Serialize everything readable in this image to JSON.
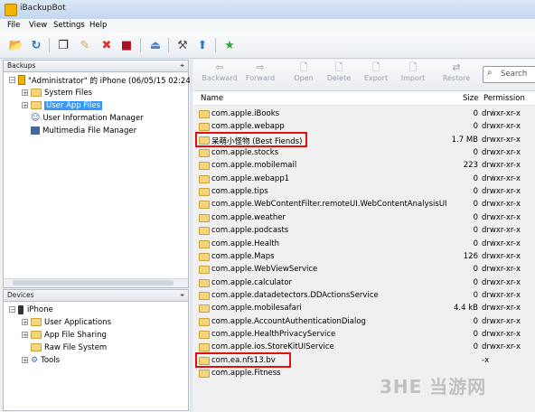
{
  "window": {
    "title": "iBackupBot"
  },
  "menu": [
    "File",
    "View",
    "Settings",
    "Help"
  ],
  "backups": {
    "header": "Backups",
    "root": "\"Administrator\" 的 iPhone (06/05/15 02:24",
    "items": [
      "System Files",
      "User App Files",
      "User Information Manager",
      "Multimedia File Manager"
    ]
  },
  "devices": {
    "header": "Devices",
    "root": "iPhone",
    "items": [
      "User Applications",
      "App File Sharing",
      "Raw File System",
      "Tools"
    ]
  },
  "right_toolbar": {
    "buttons": [
      "Backward",
      "Forward",
      "Open",
      "Delete",
      "Export",
      "Import",
      "Restore"
    ],
    "search_placeholder": "Search"
  },
  "file_list": {
    "columns": {
      "name": "Name",
      "size": "Size",
      "permission": "Permission"
    },
    "rows": [
      {
        "name": "com.apple.iBooks",
        "size": "0",
        "perm": "drwxr-xr-x"
      },
      {
        "name": "com.apple.webapp",
        "size": "0",
        "perm": "drwxr-xr-x"
      },
      {
        "name": "呆萌小怪物 (Best Fiends)",
        "size": "1.7 MB",
        "perm": "drwxr-xr-x"
      },
      {
        "name": "com.apple.stocks",
        "size": "0",
        "perm": "drwxr-xr-x"
      },
      {
        "name": "com.apple.mobilemail",
        "size": "223",
        "perm": "drwxr-xr-x"
      },
      {
        "name": "com.apple.webapp1",
        "size": "0",
        "perm": "drwxr-xr-x"
      },
      {
        "name": "com.apple.tips",
        "size": "0",
        "perm": "drwxr-xr-x"
      },
      {
        "name": "com.apple.WebContentFilter.remoteUI.WebContentAnalysisUI",
        "size": "0",
        "perm": "drwxr-xr-x"
      },
      {
        "name": "com.apple.weather",
        "size": "0",
        "perm": "drwxr-xr-x"
      },
      {
        "name": "com.apple.podcasts",
        "size": "0",
        "perm": "drwxr-xr-x"
      },
      {
        "name": "com.apple.Health",
        "size": "0",
        "perm": "drwxr-xr-x"
      },
      {
        "name": "com.apple.Maps",
        "size": "126",
        "perm": "drwxr-xr-x"
      },
      {
        "name": "com.apple.WebViewService",
        "size": "0",
        "perm": "drwxr-xr-x"
      },
      {
        "name": "com.apple.calculator",
        "size": "0",
        "perm": "drwxr-xr-x"
      },
      {
        "name": "com.apple.datadetectors.DDActionsService",
        "size": "0",
        "perm": "drwxr-xr-x"
      },
      {
        "name": "com.apple.mobilesafari",
        "size": "4.4 kB",
        "perm": "drwxr-xr-x"
      },
      {
        "name": "com.apple.AccountAuthenticationDialog",
        "size": "0",
        "perm": "drwxr-xr-x"
      },
      {
        "name": "com.apple.HealthPrivacyService",
        "size": "0",
        "perm": "drwxr-xr-x"
      },
      {
        "name": "com.apple.ios.StoreKitUIService",
        "size": "0",
        "perm": "drwxr-xr-x"
      },
      {
        "name": "com.ea.nfs13.bv",
        "size": "",
        "perm": "-x"
      },
      {
        "name": "com.apple.Fitness",
        "size": "",
        "perm": ""
      }
    ]
  },
  "watermark": "3HE 当游网"
}
